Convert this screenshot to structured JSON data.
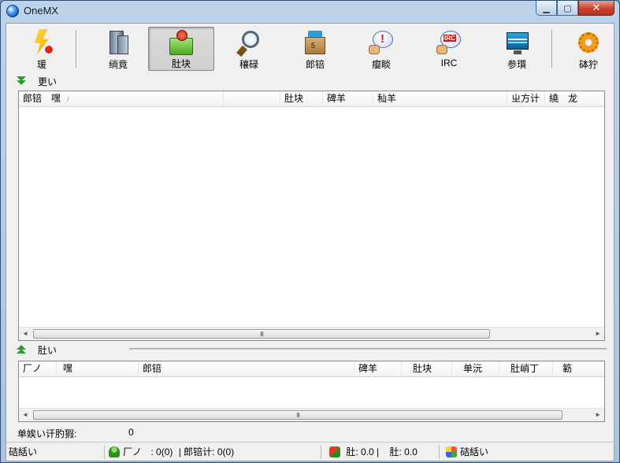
{
  "window": {
    "title": "OneMX",
    "min_label": "▁",
    "max_label": "▢",
    "close_label": "✕"
  },
  "toolbar": {
    "items": [
      {
        "id": "connect",
        "label": "瑗",
        "icon": "lightning-icon"
      },
      {
        "id": "server",
        "label": "绱竟",
        "icon": "server-icon"
      },
      {
        "id": "transfer",
        "label": "肚块",
        "icon": "folder-transfer-icon",
        "active": true
      },
      {
        "id": "search",
        "label": "穰碌",
        "icon": "magnifier-icon"
      },
      {
        "id": "library",
        "label": "郎锫",
        "icon": "package-icon"
      },
      {
        "id": "chat",
        "label": "瘿睒",
        "icon": "chat-bubble-icon"
      },
      {
        "id": "irc",
        "label": "IRC",
        "icon": "irc-icon"
      },
      {
        "id": "stats",
        "label": "参瓆",
        "icon": "monitor-icon"
      },
      {
        "id": "settings",
        "label": "砵狞",
        "icon": "gear-icon"
      }
    ]
  },
  "downloads": {
    "header": "更い",
    "columns": [
      "郎锫　嘿",
      "",
      "肚块",
      "碑羊",
      "秈羊",
      "ㄓ方计",
      "繞　龙"
    ],
    "sort_glyph": "/",
    "scroll_grip": "III"
  },
  "uploads": {
    "header": "肚い",
    "columns": [
      "厂ノ",
      "嘿",
      "郎锫",
      "碑羊",
      "肚块",
      "单沅",
      "肚峭丁",
      "簕"
    ],
    "scroll_grip": "III"
  },
  "summary": {
    "label": "单娭い讦肑猳:",
    "value": "0"
  },
  "statusbar": {
    "connection": "硈絬い",
    "users_label": "厂ノ",
    "users_value": ": 0(0)",
    "files_label": "| 郎锫计: 0(0)",
    "down_rate": "肚: 0.0 |",
    "up_rate": "肚: 0.0",
    "network": "硈絬い"
  }
}
